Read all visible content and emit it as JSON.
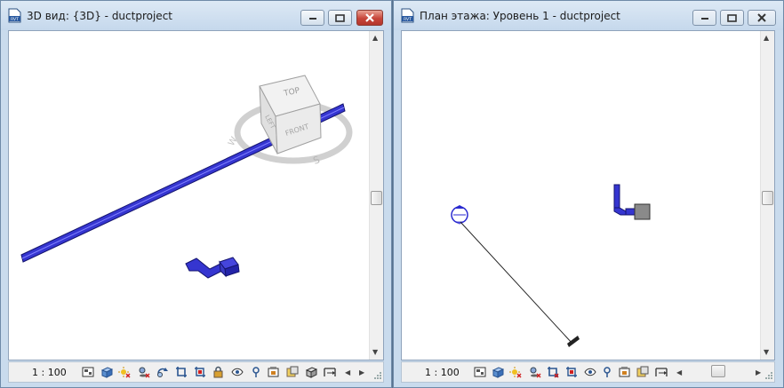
{
  "left_window": {
    "title": "3D вид: {3D} - ductproject",
    "view_cube": {
      "top_label": "TOP",
      "front_label": "FRONT",
      "left_label": "LEFT",
      "compass_s": "S"
    },
    "scale": "1 : 100"
  },
  "right_window": {
    "title": "План этажа: Уровень 1 - ductproject",
    "scale": "1 : 100"
  },
  "colors": {
    "duct": "#2f2fc8",
    "duct_dark": "#1a1a8a",
    "titlebar": "#c9dbed"
  }
}
